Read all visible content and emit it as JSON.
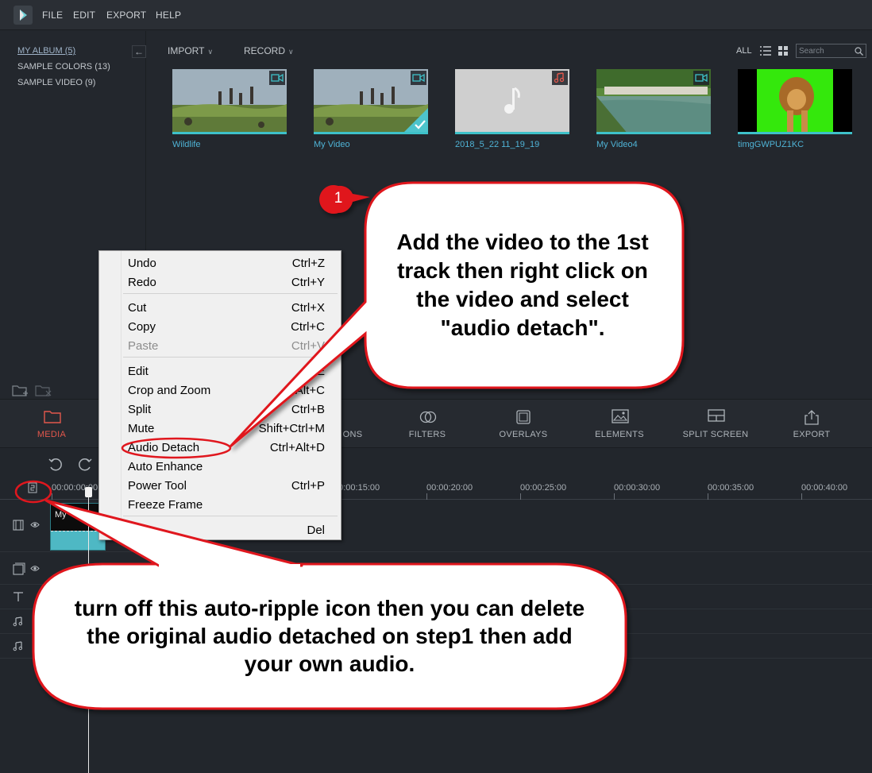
{
  "menubar": {
    "items": [
      "FILE",
      "EDIT",
      "EXPORT",
      "HELP"
    ]
  },
  "library": {
    "albums": [
      "MY ALBUM (5)",
      "SAMPLE COLORS (13)",
      "SAMPLE VIDEO (9)"
    ],
    "import_label": "IMPORT",
    "record_label": "RECORD",
    "filter_label": "ALL",
    "search_placeholder": "Search",
    "media": [
      {
        "title": "Wildlife",
        "type": "video",
        "selected": false
      },
      {
        "title": "My Video",
        "type": "video",
        "selected": true
      },
      {
        "title": "2018_5_22 11_19_19",
        "type": "audio",
        "selected": false
      },
      {
        "title": "My Video4",
        "type": "video",
        "selected": false
      },
      {
        "title": "timgGWPUZ1KC",
        "type": "image",
        "selected": false
      }
    ]
  },
  "tabs": [
    {
      "label": "MEDIA",
      "icon": "folder-icon"
    },
    {
      "label": "ONS",
      "icon": "transitions-icon"
    },
    {
      "label": "FILTERS",
      "icon": "filters-icon"
    },
    {
      "label": "OVERLAYS",
      "icon": "overlays-icon"
    },
    {
      "label": "ELEMENTS",
      "icon": "elements-icon"
    },
    {
      "label": "SPLIT SCREEN",
      "icon": "split-screen-icon"
    },
    {
      "label": "EXPORT",
      "icon": "export-icon"
    }
  ],
  "timeline": {
    "ruler_ticks": [
      "00:00:00:00",
      "00:00:15:00",
      "00:00:20:00",
      "00:00:25:00",
      "00:00:30:00",
      "00:00:35:00",
      "00:00:40:00"
    ],
    "clip_name": "My"
  },
  "context_menu": {
    "groups": [
      [
        {
          "label": "Undo",
          "shortcut": "Ctrl+Z"
        },
        {
          "label": "Redo",
          "shortcut": "Ctrl+Y"
        }
      ],
      [
        {
          "label": "Cut",
          "shortcut": "Ctrl+X"
        },
        {
          "label": "Copy",
          "shortcut": "Ctrl+C"
        },
        {
          "label": "Paste",
          "shortcut": "Ctrl+V",
          "disabled": true
        }
      ],
      [
        {
          "label": "Edit",
          "shortcut": "E"
        },
        {
          "label": "Crop and Zoom",
          "shortcut": "Alt+C"
        },
        {
          "label": "Split",
          "shortcut": "Ctrl+B"
        },
        {
          "label": "Mute",
          "shortcut": "Shift+Ctrl+M"
        },
        {
          "label": "Audio Detach",
          "shortcut": "Ctrl+Alt+D"
        },
        {
          "label": "Auto Enhance",
          "shortcut": ""
        },
        {
          "label": "Power Tool",
          "shortcut": "Ctrl+P"
        },
        {
          "label": "Freeze Frame",
          "shortcut": ""
        }
      ],
      [
        {
          "label": "",
          "shortcut": "Del"
        }
      ]
    ]
  },
  "annotations": {
    "step_number": "1",
    "callout_1": "Add the video to the 1st track then right click on the video and select \"audio detach\".",
    "callout_2": "turn off this auto-ripple icon then you can delete the original audio detached on step1 then add your own audio.",
    "accent_red": "#e0171e"
  },
  "colors": {
    "teal_accent": "#3ec1c9",
    "media_tab_red": "#e2574c",
    "title_blue": "#4fb3d6"
  }
}
